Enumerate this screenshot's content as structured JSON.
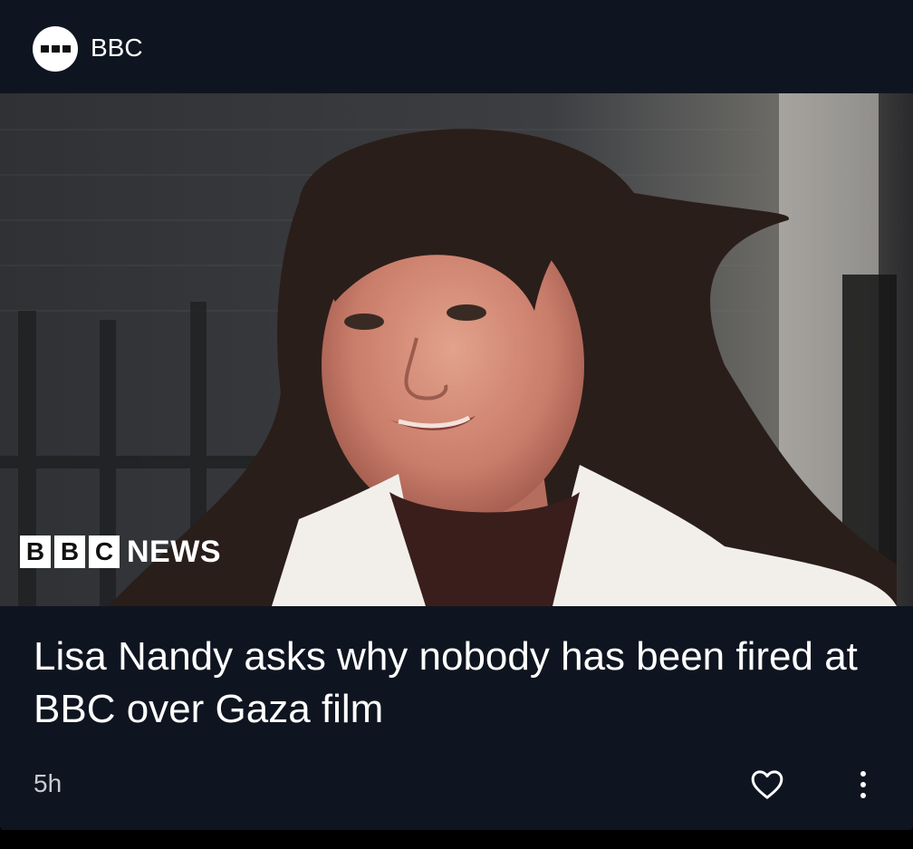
{
  "source": {
    "name": "BBC",
    "logo_icon": "bbc-logo-icon"
  },
  "article": {
    "image_caption_brand": {
      "blocks": [
        "B",
        "B",
        "C"
      ],
      "word": "NEWS"
    },
    "headline": "Lisa Nandy asks why nobody has been fired at BBC over Gaza film",
    "age": "5h",
    "like_icon": "heart-outline-icon",
    "menu_icon": "more-vertical-icon"
  },
  "colors": {
    "card_bg": "#0f1520",
    "text": "#ffffff",
    "meta": "#c8cbd2"
  }
}
